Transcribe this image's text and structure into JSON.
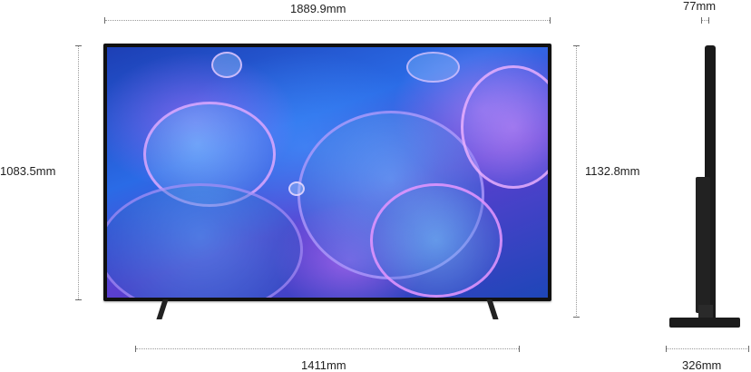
{
  "dimensions": {
    "width_top": "1889.9mm",
    "height_left": "1083.5mm",
    "height_right": "1132.8mm",
    "stand_width": "1411mm",
    "depth_top": "77mm",
    "depth_stand": "326mm"
  }
}
